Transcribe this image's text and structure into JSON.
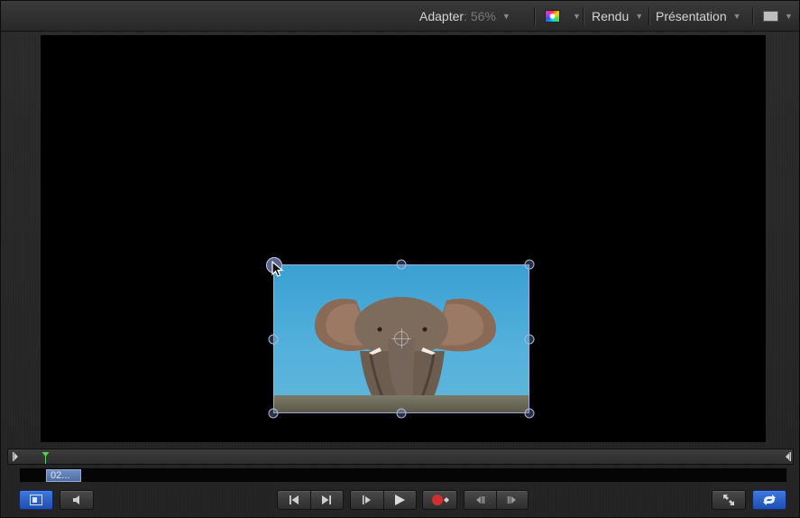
{
  "toolbar": {
    "zoom_label": "Adapter",
    "zoom_value": " : 56%",
    "color_menu_icon": "color-wheel-icon",
    "render_label": "Rendu",
    "view_label": "Présentation",
    "layout_icon": "view-layout-icon"
  },
  "canvas": {
    "background": "#000000",
    "layer": {
      "type": "image",
      "subject": "elephant-image",
      "selected": true
    }
  },
  "timeline": {
    "clip_label": "02..."
  },
  "colors": {
    "accent_blue": "#2a5fcf",
    "clip_blue": "#5d7db4",
    "playhead_green": "#4bd04b",
    "record_red": "#d23030"
  }
}
